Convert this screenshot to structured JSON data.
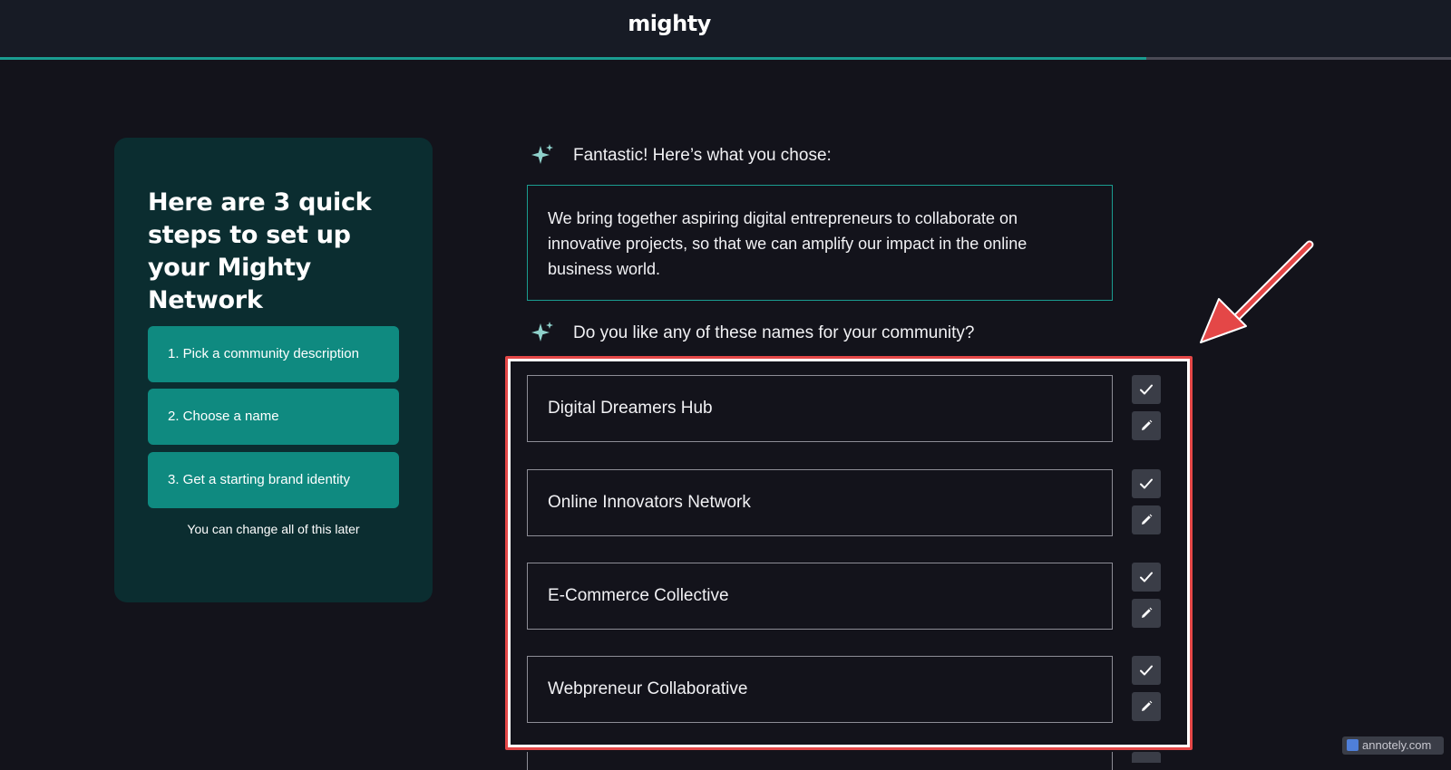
{
  "header": {
    "logo_text": "mighty",
    "progress": 0.79
  },
  "sidebar": {
    "title": "Here are 3 quick steps to set up your Mighty Network",
    "steps": [
      "1. Pick a community description",
      "2. Choose a name",
      "3. Get a starting brand identity"
    ],
    "note": "You can change all of this later"
  },
  "main": {
    "chosen_prompt": "Fantastic! Here’s what you chose:",
    "description": "We bring together aspiring digital entrepreneurs to collaborate on innovative projects, so that we can amplify our impact in the online business world.",
    "names_prompt": "Do you like any of these names for your community?",
    "names": [
      "Digital Dreamers Hub",
      "Online Innovators Network",
      "E-Commerce Collective",
      "Webpreneur Collaborative"
    ]
  },
  "annotation": {
    "highlight_color": "#e44747"
  },
  "colors": {
    "accent": "#1a9c90",
    "background": "#13131b",
    "sidebar": "#0b2d30",
    "step": "#0f8a80"
  },
  "icons": {
    "sparkle": "sparkle-icon",
    "accept": "checkmark-icon",
    "edit": "pencil-icon"
  },
  "watermark": {
    "text": "annotely.com"
  }
}
